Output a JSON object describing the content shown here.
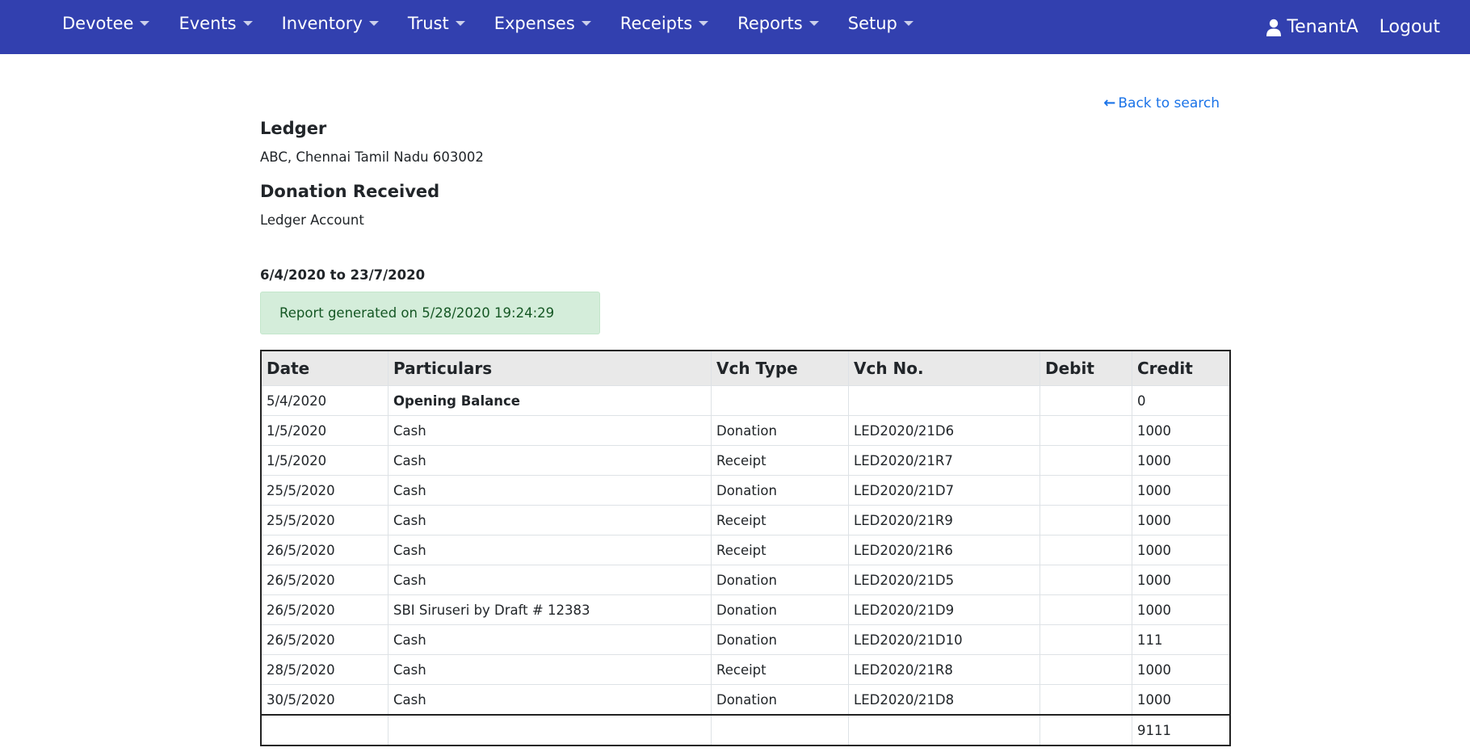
{
  "nav": {
    "menus": [
      "Devotee",
      "Events",
      "Inventory",
      "Trust",
      "Expenses",
      "Receipts",
      "Reports",
      "Setup"
    ],
    "user": "TenantA",
    "logout": "Logout"
  },
  "page": {
    "back_link": "Back to search",
    "title": "Ledger",
    "address": "ABC, Chennai Tamil Nadu 603002",
    "account_name": "Donation Received",
    "subtitle": "Ledger Account",
    "date_range": "6/4/2020 to 23/7/2020",
    "generated": "Report generated on 5/28/2020 19:24:29"
  },
  "table": {
    "headers": [
      "Date",
      "Particulars",
      "Vch Type",
      "Vch No.",
      "Debit",
      "Credit"
    ],
    "rows": [
      [
        "5/4/2020",
        "Opening Balance",
        "",
        "",
        "",
        "0"
      ],
      [
        "1/5/2020",
        "Cash",
        "Donation",
        "LED2020/21D6",
        "",
        "1000"
      ],
      [
        "1/5/2020",
        "Cash",
        "Receipt",
        "LED2020/21R7",
        "",
        "1000"
      ],
      [
        "25/5/2020",
        "Cash",
        "Donation",
        "LED2020/21D7",
        "",
        "1000"
      ],
      [
        "25/5/2020",
        "Cash",
        "Receipt",
        "LED2020/21R9",
        "",
        "1000"
      ],
      [
        "26/5/2020",
        "Cash",
        "Receipt",
        "LED2020/21R6",
        "",
        "1000"
      ],
      [
        "26/5/2020",
        "Cash",
        "Donation",
        "LED2020/21D5",
        "",
        "1000"
      ],
      [
        "26/5/2020",
        "SBI Siruseri by Draft # 12383",
        "Donation",
        "LED2020/21D9",
        "",
        "1000"
      ],
      [
        "26/5/2020",
        "Cash",
        "Donation",
        "LED2020/21D10",
        "",
        "111"
      ],
      [
        "28/5/2020",
        "Cash",
        "Receipt",
        "LED2020/21R8",
        "",
        "1000"
      ],
      [
        "30/5/2020",
        "Cash",
        "Donation",
        "LED2020/21D8",
        "",
        "1000"
      ]
    ],
    "total_row": [
      "",
      "",
      "",
      "",
      "",
      "9111"
    ]
  }
}
